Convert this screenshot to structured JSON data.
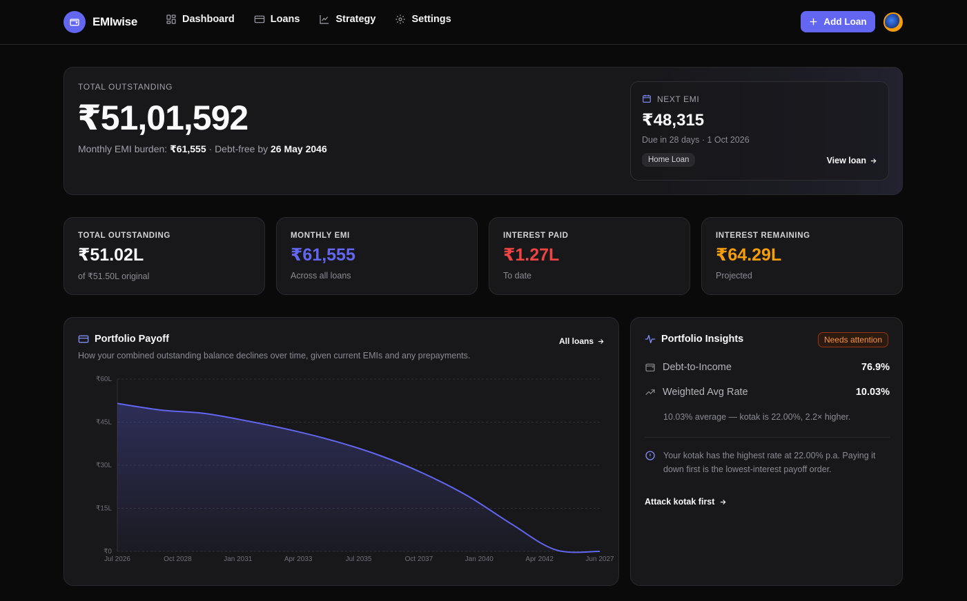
{
  "app": {
    "name": "EMIwise"
  },
  "nav": {
    "links": [
      {
        "label": "Dashboard",
        "icon": "grid-icon"
      },
      {
        "label": "Loans",
        "icon": "card-icon"
      },
      {
        "label": "Strategy",
        "icon": "chart-line-icon"
      },
      {
        "label": "Settings",
        "icon": "gear-icon"
      }
    ],
    "add_loan_label": "Add Loan"
  },
  "hero": {
    "eyebrow": "TOTAL OUTSTANDING",
    "amount": "₹51,01,592",
    "burden_label": "Monthly EMI burden: ",
    "burden_value": "₹61,555",
    "debtfree_label": " · Debt-free by ",
    "debtfree_value": "26 May 2046",
    "next_emi": {
      "eyebrow": "NEXT EMI",
      "amount": "₹48,315",
      "due": "Due in 28 days · 1 Oct 2026",
      "loan_chip": "Home Loan",
      "view_label": "View loan"
    }
  },
  "stats": [
    {
      "label": "TOTAL OUTSTANDING",
      "value": "₹51.02L",
      "note": "of ₹51.50L original",
      "color": "#fafafa"
    },
    {
      "label": "MONTHLY EMI",
      "value": "₹61,555",
      "note": "Across all loans",
      "color": "#6366f1"
    },
    {
      "label": "INTEREST PAID",
      "value": "₹1.27L",
      "note": "To date",
      "color": "#ef4444"
    },
    {
      "label": "INTEREST REMAINING",
      "value": "₹64.29L",
      "note": "Projected",
      "color": "#f59e0b"
    }
  ],
  "payoff": {
    "title": "Portfolio Payoff",
    "description": "How your combined outstanding balance declines over time, given current EMIs and any prepayments.",
    "all_loans_label": "All loans"
  },
  "chart_data": {
    "type": "area",
    "title": "Portfolio Payoff",
    "x_tick_labels": [
      "Jul 2026",
      "Oct 2028",
      "Jan 2031",
      "Apr 2033",
      "Jul 2035",
      "Oct 2037",
      "Jan 2040",
      "Apr 2042",
      "Jun 2027"
    ],
    "y_tick_labels": [
      "₹60L",
      "₹45L",
      "₹30L",
      "₹15L",
      "₹0"
    ],
    "ylim": [
      0,
      60
    ],
    "y_unit": "lakh ₹",
    "series": [
      {
        "x": [
          "Jul 2026",
          "Jan 2027",
          "Oct 2028",
          "Jan 2031",
          "Apr 2033",
          "Jul 2035",
          "Oct 2037",
          "Jan 2040",
          "Apr 2042",
          "Oct 2044",
          "Jun 2046",
          "Jun 2027"
        ],
        "values": [
          51.5,
          49.2,
          48.0,
          45.3,
          42.1,
          38.2,
          33.3,
          27.0,
          19.2,
          9.4,
          0.5,
          0.0
        ]
      }
    ],
    "grid": true,
    "line_color": "#6366f1"
  },
  "insights": {
    "title": "Portfolio Insights",
    "badge": "Needs attention",
    "metrics": [
      {
        "label": "Debt-to-Income",
        "value": "76.9%",
        "icon": "wallet-icon"
      },
      {
        "label": "Weighted Avg Rate",
        "value": "10.03%",
        "icon": "trending-up-icon"
      }
    ],
    "rate_note": "10.03% average — kotak is 22.00%, 2.2× higher.",
    "tip": "Your kotak has the highest rate at 22.00% p.a. Paying it down first is the lowest-interest payoff order.",
    "action_label": "Attack kotak first"
  }
}
